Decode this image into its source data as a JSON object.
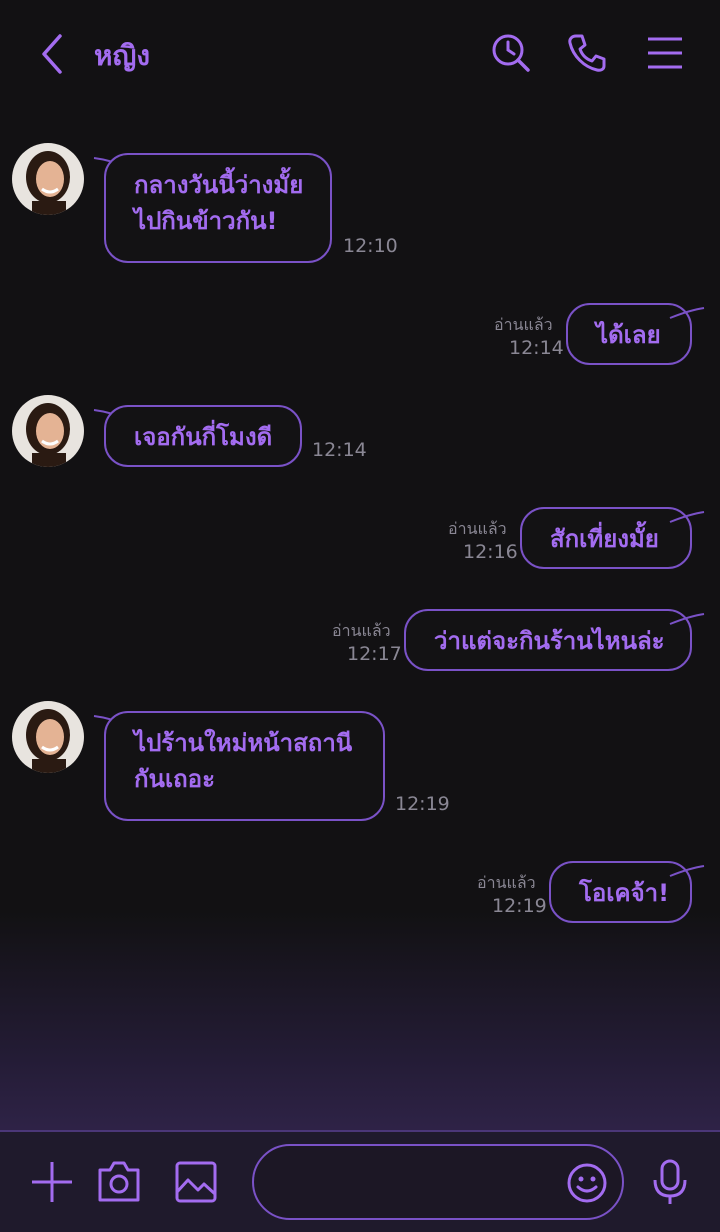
{
  "header": {
    "title": "หญิง"
  },
  "messages": [
    {
      "side": "in",
      "lines": [
        "กลางวันนี้ว่างมั้ย",
        "ไปกินข้าวกัน!"
      ],
      "time": "12:10"
    },
    {
      "side": "out",
      "lines": [
        "ได้เลย"
      ],
      "time": "12:14",
      "read": "อ่านแล้ว"
    },
    {
      "side": "in",
      "lines": [
        "เจอกันกี่โมงดี"
      ],
      "time": "12:14"
    },
    {
      "side": "out",
      "lines": [
        "สักเที่ยงมั้ย"
      ],
      "time": "12:16",
      "read": "อ่านแล้ว"
    },
    {
      "side": "out",
      "lines": [
        "ว่าแต่จะกินร้านไหนล่ะ"
      ],
      "time": "12:17",
      "read": "อ่านแล้ว"
    },
    {
      "side": "in",
      "lines": [
        "ไปร้านใหม่หน้าสถานี",
        "กันเถอะ"
      ],
      "time": "12:19"
    },
    {
      "side": "out",
      "lines": [
        "โอเคจ้า!"
      ],
      "time": "12:19",
      "read": "อ่านแล้ว"
    }
  ],
  "input": {
    "placeholder": ""
  },
  "icons": {
    "back": "chevron-left-icon",
    "search": "search-icon",
    "call": "phone-icon",
    "menu": "menu-icon",
    "add": "plus-icon",
    "camera": "camera-icon",
    "image": "image-icon",
    "emoji": "emoji-icon",
    "mic": "mic-icon"
  },
  "colors": {
    "accent": "#a36cf0",
    "bubble_border": "#7a52c7",
    "background": "#121113",
    "muted": "#8a8794"
  }
}
